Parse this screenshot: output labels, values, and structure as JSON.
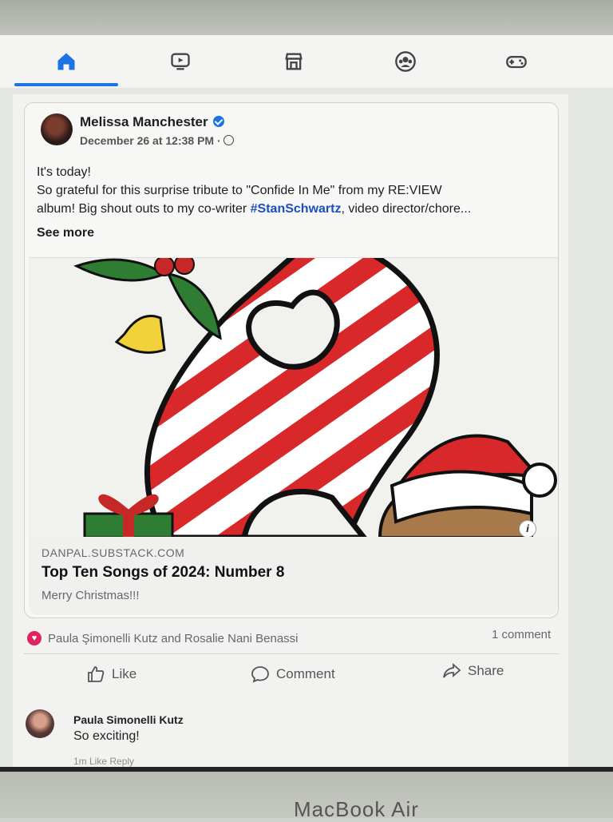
{
  "nav": {
    "items": [
      {
        "name": "home",
        "active": true
      },
      {
        "name": "video"
      },
      {
        "name": "marketplace"
      },
      {
        "name": "groups"
      },
      {
        "name": "gaming"
      }
    ],
    "accent": "#1b74e4"
  },
  "post": {
    "author": "Melissa Manchester",
    "timestamp": "December 26 at 12:38 PM ·",
    "text_line1": "It's today!",
    "text_line2": "So grateful for this surprise tribute to \"Confide In Me\" from my RE:VIEW",
    "text_line3_a": "album!  Big shout outs to my co-writer ",
    "hashtag": "#StanSchwartz",
    "text_line3_b": ", video director/chore...",
    "see_more": "See more"
  },
  "link": {
    "domain": "DANPAL.SUBSTACK.COM",
    "title": "Top Ten Songs of 2024: Number 8",
    "description": "Merry Christmas!!!",
    "info_icon": "i"
  },
  "engagement": {
    "reactors": "Paula Şimonelli Kutz and Rosalie Nani Benassi",
    "comment_count": "1 comment",
    "like": "Like",
    "comment": "Comment",
    "share": "Share"
  },
  "comment": {
    "name": "Paula Simonelli Kutz",
    "text": "So exciting!",
    "meta": "1m    Like    Reply"
  },
  "device": {
    "label": "MacBook Air"
  }
}
